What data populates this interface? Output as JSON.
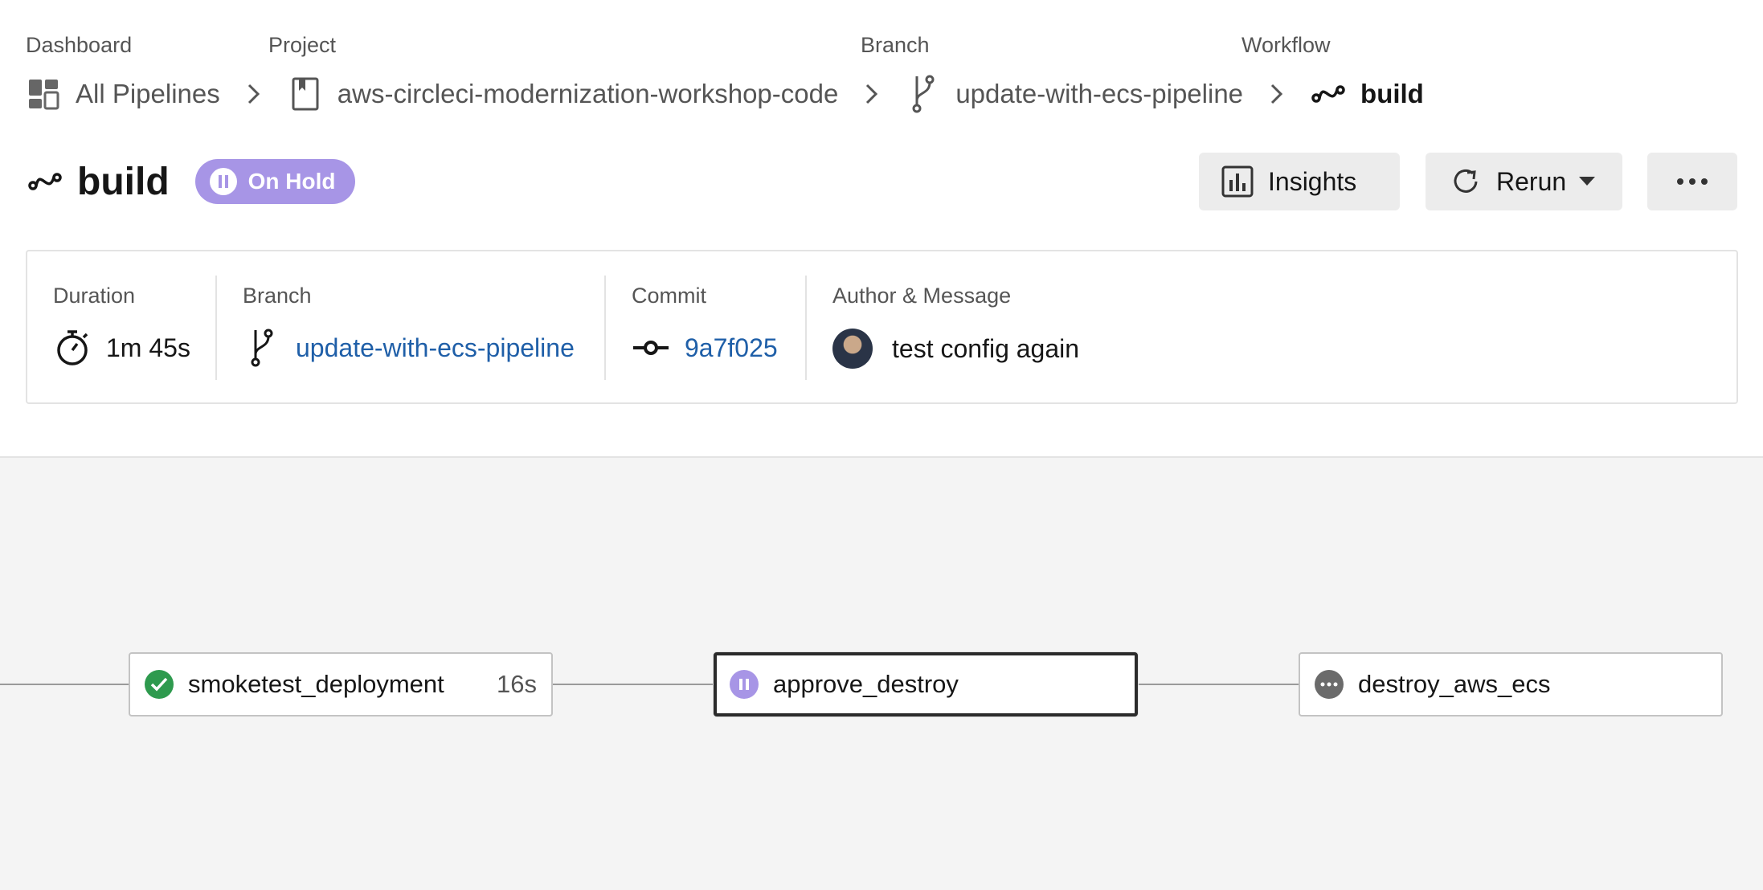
{
  "breadcrumb": {
    "dashboard": {
      "caption": "Dashboard",
      "label": "All Pipelines",
      "icon": "dashboard-icon"
    },
    "project": {
      "caption": "Project",
      "label": "aws-circleci-modernization-workshop-code",
      "icon": "repo-icon"
    },
    "branch": {
      "caption": "Branch",
      "label": "update-with-ecs-pipeline",
      "icon": "branch-icon"
    },
    "workflow": {
      "caption": "Workflow",
      "label": "build",
      "icon": "workflow-icon"
    }
  },
  "header": {
    "title": "build",
    "status": "On Hold",
    "status_color": "#a795e6",
    "insights_label": "Insights",
    "rerun_label": "Rerun"
  },
  "info": {
    "duration": {
      "label": "Duration",
      "value": "1m 45s"
    },
    "branch": {
      "label": "Branch",
      "value": "update-with-ecs-pipeline"
    },
    "commit": {
      "label": "Commit",
      "value": "9a7f025"
    },
    "author": {
      "label": "Author & Message",
      "message": "test config again"
    }
  },
  "graph": {
    "jobs": [
      {
        "name": "smoketest_deployment",
        "status": "success",
        "duration": "16s",
        "status_color": "#2e9a4e"
      },
      {
        "name": "approve_destroy",
        "status": "on-hold",
        "duration": "",
        "status_color": "#a795e6"
      },
      {
        "name": "destroy_aws_ecs",
        "status": "not-run",
        "duration": "",
        "status_color": "#6b6b6b"
      }
    ]
  },
  "colors": {
    "link": "#1f5fa8",
    "graph_bg": "#f4f4f4"
  }
}
